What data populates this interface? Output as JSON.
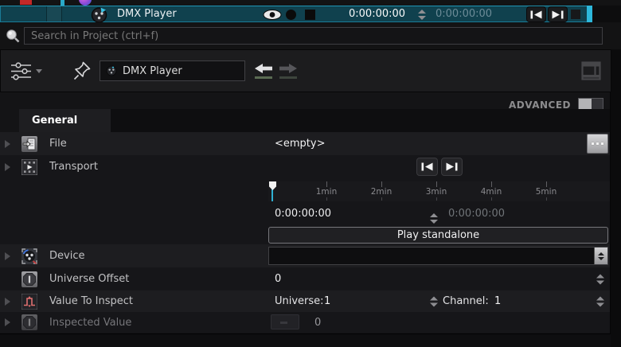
{
  "top_bar": {
    "title": "DMX Player",
    "timecode_current": "0:00:00:00",
    "timecode_total": "0:00:00:00"
  },
  "search": {
    "placeholder": "Search in Project (ctrl+f)"
  },
  "toolbar": {
    "selected_item": "DMX Player"
  },
  "panel": {
    "advanced_label": "ADVANCED",
    "tab_label": "General",
    "file": {
      "label": "File",
      "value": "<empty>"
    },
    "transport": {
      "label": "Transport",
      "ticks": [
        "1min",
        "2min",
        "3min",
        "4min",
        "5min"
      ],
      "timecode_current": "0:00:00:00",
      "timecode_total": "0:00:00:00",
      "play_label": "Play standalone"
    },
    "device": {
      "label": "Device",
      "value": ""
    },
    "universe_offset": {
      "label": "Universe Offset",
      "value": "0"
    },
    "value_to_inspect": {
      "label": "Value To Inspect",
      "universe_label": "Universe:",
      "universe_value": "1",
      "channel_label": "Channel:",
      "channel_value": "1"
    },
    "inspected_value": {
      "label": "Inspected Value",
      "value": "0"
    }
  },
  "icons": {
    "browse_button": "ellipsis",
    "accent_color": "#2db8dc",
    "selection_color": "#10414e"
  }
}
